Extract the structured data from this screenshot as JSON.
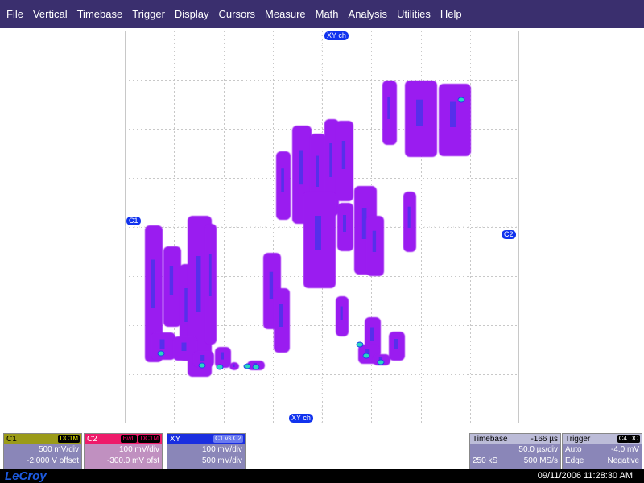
{
  "menu": [
    "File",
    "Vertical",
    "Timebase",
    "Trigger",
    "Display",
    "Cursors",
    "Measure",
    "Math",
    "Analysis",
    "Utilities",
    "Help"
  ],
  "markers": {
    "top": "XY ch",
    "left": "C1",
    "right": "C2",
    "bottom": "XY ch"
  },
  "colors": {
    "menubar": "#3a2f6e",
    "trace_main": "#9a1cf0",
    "trace_hot": "#1f3fe8",
    "trace_peak": "#29d8c0",
    "grid": "#c8c8c8"
  },
  "channels": {
    "c1": {
      "label": "C1",
      "coupling": "DC1M",
      "scale": "500 mV/div",
      "offset": "-2.000 V offset"
    },
    "c2": {
      "label": "C2",
      "bw": "BwL",
      "coupling": "DC1M",
      "scale": "100 mV/div",
      "offset": "-300.0 mV ofst"
    },
    "xy": {
      "label": "XY",
      "source": "C1 vs C2",
      "scale_y": "100 mV/div",
      "scale_x": "500 mV/div"
    }
  },
  "timebase": {
    "label": "Timebase",
    "delay": "-166 µs",
    "div": "50.0 µs/div",
    "samples": "250 kS",
    "rate": "500 MS/s"
  },
  "trigger": {
    "label": "Trigger",
    "source": "C4",
    "coupling": "DC",
    "mode": "Auto",
    "level": "-4.0 mV",
    "type": "Edge",
    "slope": "Negative"
  },
  "footer": {
    "brand": "LeCroy",
    "datetime": "09/11/2006 11:28:30 AM"
  }
}
